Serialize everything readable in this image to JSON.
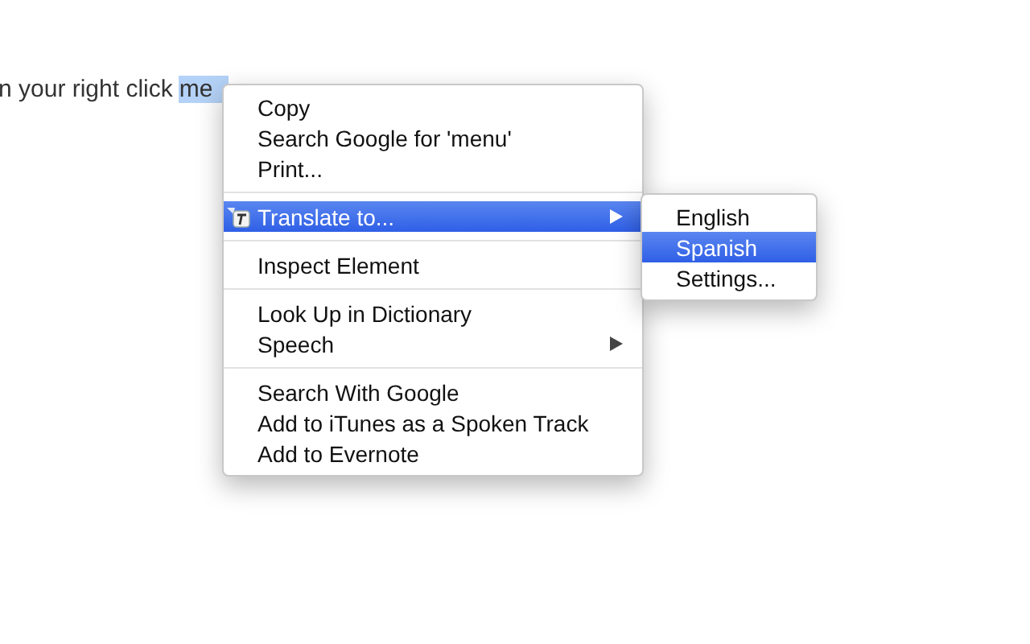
{
  "page_text": {
    "before": "n your right click",
    "selection": "me"
  },
  "context_menu": {
    "groups": [
      {
        "items": [
          {
            "label": "Copy",
            "selected": false,
            "submenu": false,
            "icon": false
          },
          {
            "label": "Search Google for 'menu'",
            "selected": false,
            "submenu": false,
            "icon": false
          },
          {
            "label": "Print...",
            "selected": false,
            "submenu": false,
            "icon": false
          }
        ]
      },
      {
        "items": [
          {
            "label": "Translate to...",
            "selected": true,
            "submenu": true,
            "icon": true
          }
        ]
      },
      {
        "items": [
          {
            "label": "Inspect Element",
            "selected": false,
            "submenu": false,
            "icon": false
          }
        ]
      },
      {
        "items": [
          {
            "label": "Look Up in Dictionary",
            "selected": false,
            "submenu": false,
            "icon": false
          },
          {
            "label": "Speech",
            "selected": false,
            "submenu": true,
            "icon": false
          }
        ]
      },
      {
        "items": [
          {
            "label": "Search With Google",
            "selected": false,
            "submenu": false,
            "icon": false
          },
          {
            "label": "Add to iTunes as a Spoken Track",
            "selected": false,
            "submenu": false,
            "icon": false
          },
          {
            "label": "Add to Evernote",
            "selected": false,
            "submenu": false,
            "icon": false
          }
        ]
      }
    ]
  },
  "submenu": {
    "items": [
      {
        "label": "English",
        "selected": false
      },
      {
        "label": "Spanish",
        "selected": true
      },
      {
        "label": "Settings...",
        "selected": false
      }
    ]
  }
}
